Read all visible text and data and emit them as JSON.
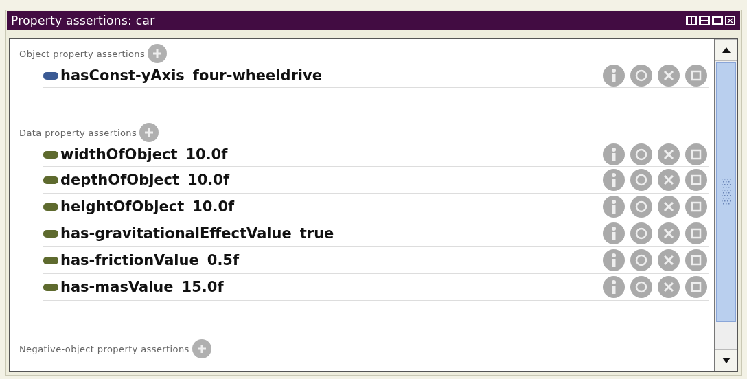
{
  "window": {
    "title": "Property assertions: car"
  },
  "sections": [
    {
      "kind": "object",
      "title": "Object property assertions",
      "rows": [
        {
          "property": "hasConst-yAxis",
          "value": "four-wheeldrive"
        }
      ]
    },
    {
      "kind": "data",
      "title": "Data property assertions",
      "rows": [
        {
          "property": "widthOfObject",
          "value": "10.0f"
        },
        {
          "property": "depthOfObject",
          "value": "10.0f"
        },
        {
          "property": "heightOfObject",
          "value": "10.0f"
        },
        {
          "property": "has-gravitationalEffectValue",
          "value": "true"
        },
        {
          "property": "has-frictionValue",
          "value": "0.5f"
        },
        {
          "property": "has-masValue",
          "value": "15.0f"
        }
      ]
    },
    {
      "kind": "negative",
      "title": "Negative-object property assertions"
    }
  ]
}
